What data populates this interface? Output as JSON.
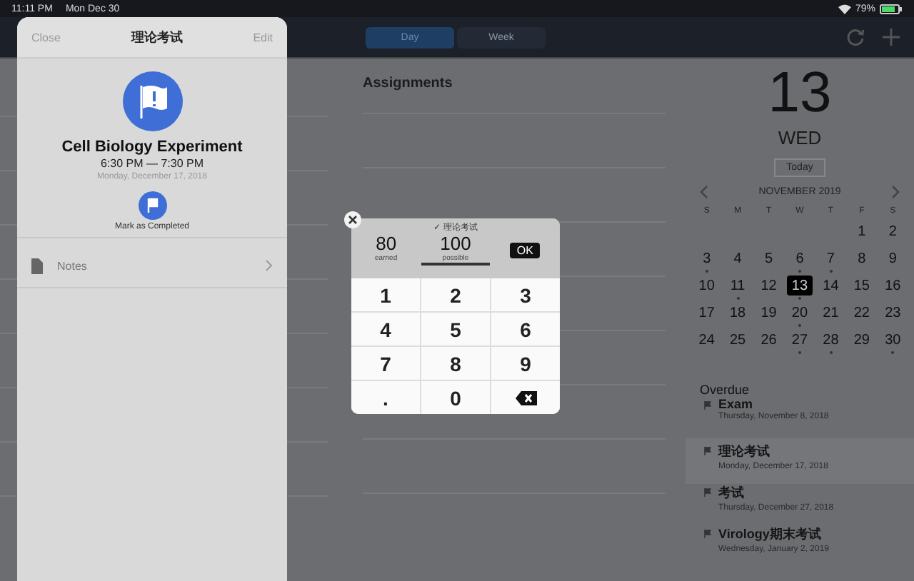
{
  "status_bar": {
    "time": "11:11 PM",
    "date": "Mon Dec 30",
    "battery": "79%"
  },
  "nav": {
    "tabs": [
      {
        "label": "Day",
        "selected": true
      },
      {
        "label": "Week",
        "selected": false
      }
    ]
  },
  "assignments": {
    "title": "Assignments"
  },
  "date_panel": {
    "day_number": "13",
    "weekday": "WED",
    "today_button": "Today"
  },
  "calendar": {
    "month": "NOVEMBER 2019",
    "weekdays": [
      "S",
      "M",
      "T",
      "W",
      "T",
      "F",
      "S"
    ],
    "weeks": [
      [
        {
          "label": "1",
          "selected": false,
          "dot": false
        },
        {
          "label": "2",
          "selected": false,
          "dot": false
        }
      ],
      [
        {
          "label": "3",
          "selected": false,
          "dot": true
        },
        {
          "label": "4",
          "selected": false,
          "dot": false
        },
        {
          "label": "5",
          "selected": false,
          "dot": false
        },
        {
          "label": "6",
          "selected": false,
          "dot": true
        },
        {
          "label": "7",
          "selected": false,
          "dot": true
        },
        {
          "label": "8",
          "selected": false,
          "dot": false
        },
        {
          "label": "9",
          "selected": false,
          "dot": false
        }
      ],
      [
        {
          "label": "10",
          "selected": false,
          "dot": false
        },
        {
          "label": "11",
          "selected": false,
          "dot": true
        },
        {
          "label": "12",
          "selected": false,
          "dot": false
        },
        {
          "label": "13",
          "selected": true,
          "dot": true
        },
        {
          "label": "14",
          "selected": false,
          "dot": false
        },
        {
          "label": "15",
          "selected": false,
          "dot": false
        },
        {
          "label": "16",
          "selected": false,
          "dot": false
        }
      ],
      [
        {
          "label": "17",
          "selected": false,
          "dot": false
        },
        {
          "label": "18",
          "selected": false,
          "dot": false
        },
        {
          "label": "19",
          "selected": false,
          "dot": false
        },
        {
          "label": "20",
          "selected": false,
          "dot": true
        },
        {
          "label": "21",
          "selected": false,
          "dot": false
        },
        {
          "label": "22",
          "selected": false,
          "dot": false
        },
        {
          "label": "23",
          "selected": false,
          "dot": false
        }
      ],
      [
        {
          "label": "24",
          "selected": false,
          "dot": false
        },
        {
          "label": "25",
          "selected": false,
          "dot": false
        },
        {
          "label": "26",
          "selected": false,
          "dot": false
        },
        {
          "label": "27",
          "selected": false,
          "dot": true
        },
        {
          "label": "28",
          "selected": false,
          "dot": true
        },
        {
          "label": "29",
          "selected": false,
          "dot": false
        },
        {
          "label": "30",
          "selected": false,
          "dot": true
        }
      ]
    ]
  },
  "overdue": {
    "title": "Overdue",
    "items": [
      {
        "title": "Exam",
        "date": "Thursday, November 8, 2018",
        "selected": false
      },
      {
        "title": "理论考试",
        "date": "Monday, December 17, 2018",
        "selected": true
      },
      {
        "title": "考试",
        "date": "Thursday, December 27, 2018",
        "selected": false
      },
      {
        "title": "Virology期末考试",
        "date": "Wednesday, January 2, 2019",
        "selected": false
      }
    ]
  },
  "sheet": {
    "close": "Close",
    "title": "理论考试",
    "edit": "Edit",
    "event_title": "Cell Biology Experiment",
    "time": "6:30 PM — 7:30 PM",
    "date": "Monday, December 17, 2018",
    "mark_label": "Mark as Completed",
    "notes_label": "Notes"
  },
  "keypad": {
    "header": "✓ 理论考试",
    "fields": [
      {
        "value": "80",
        "label": "earned",
        "selected": false
      },
      {
        "value": "100",
        "label": "possible",
        "selected": true
      }
    ],
    "ok": "OK",
    "keys": [
      {
        "kind": "digit",
        "label": "1"
      },
      {
        "kind": "digit",
        "label": "2"
      },
      {
        "kind": "digit",
        "label": "3"
      },
      {
        "kind": "digit",
        "label": "4"
      },
      {
        "kind": "digit",
        "label": "5"
      },
      {
        "kind": "digit",
        "label": "6"
      },
      {
        "kind": "digit",
        "label": "7"
      },
      {
        "kind": "digit",
        "label": "8"
      },
      {
        "kind": "digit",
        "label": "9"
      },
      {
        "kind": "digit",
        "label": "."
      },
      {
        "kind": "digit",
        "label": "0"
      },
      {
        "kind": "backspace"
      }
    ]
  }
}
